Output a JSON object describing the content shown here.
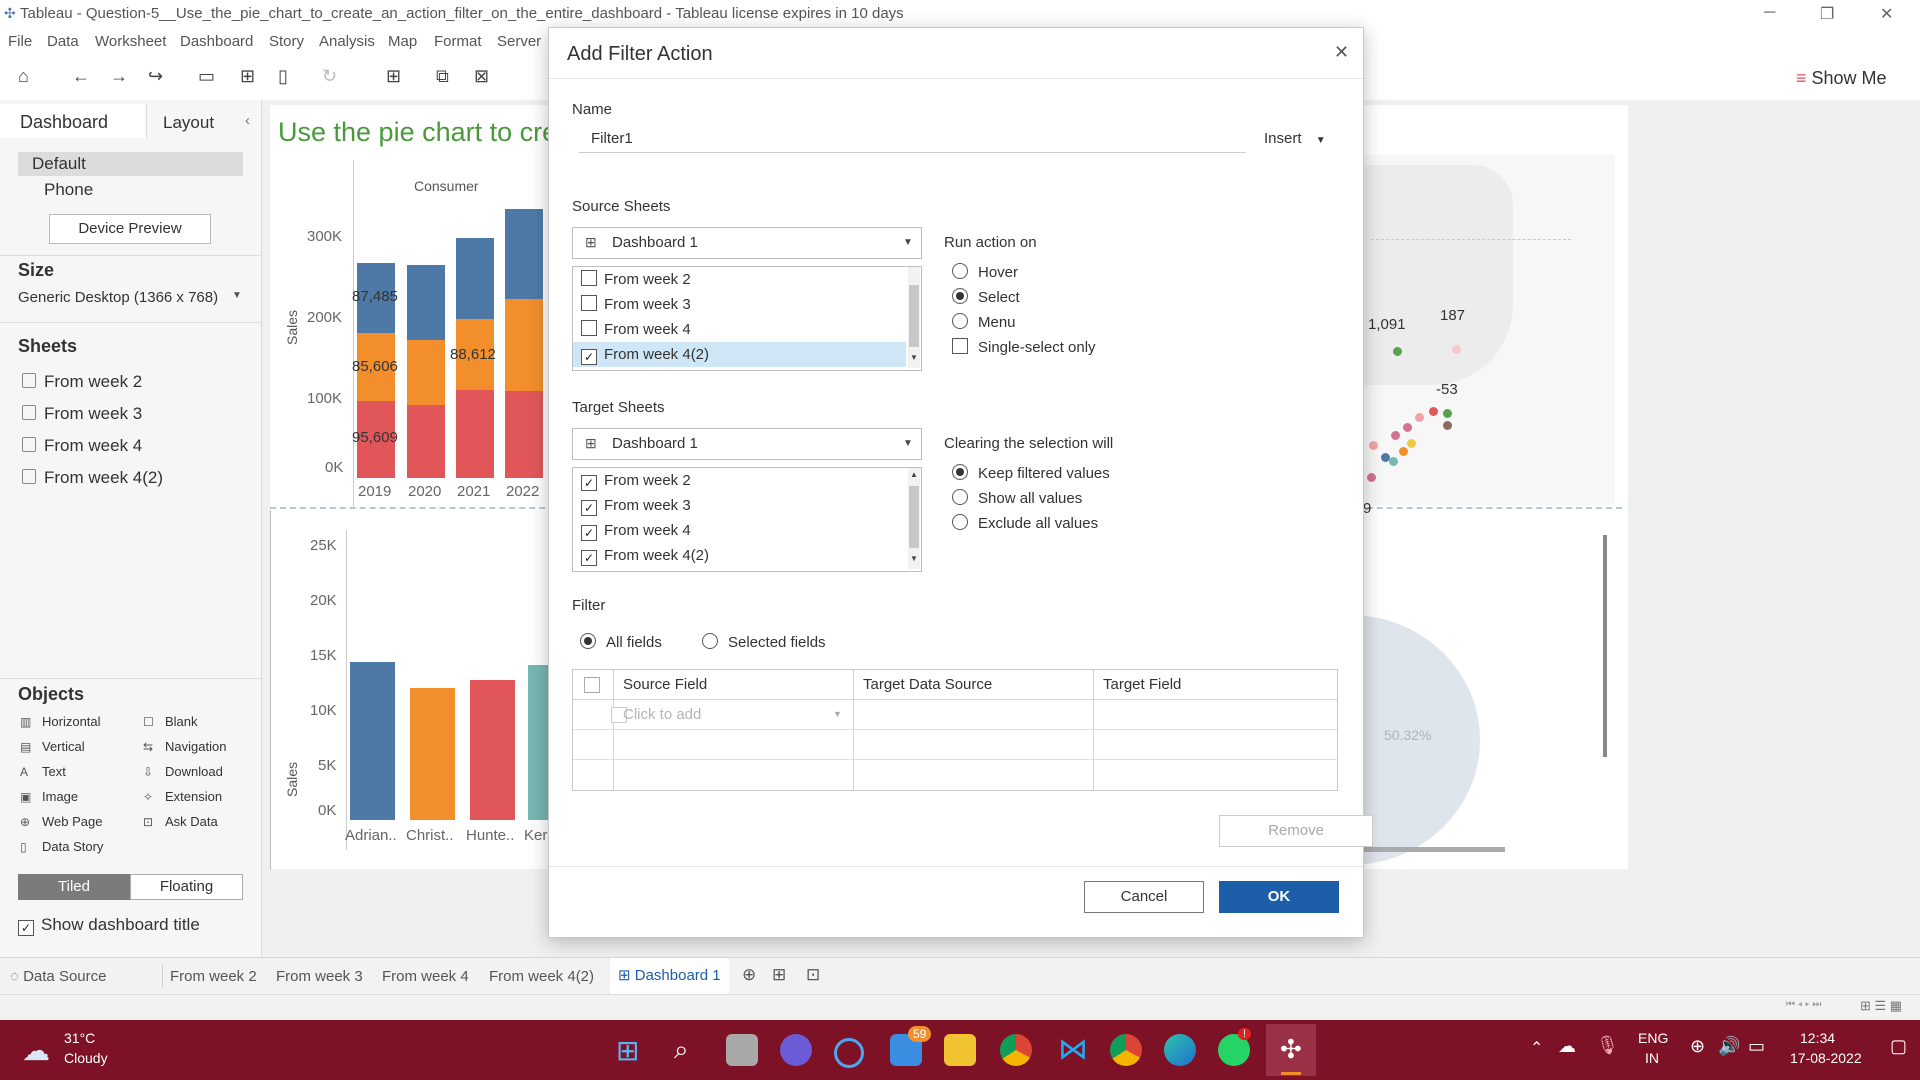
{
  "window": {
    "title": "Tableau - Question-5__Use_the_pie_chart_to_create_an_action_filter_on_the_entire_dashboard - Tableau license expires in 10 days"
  },
  "menu": [
    "File",
    "Data",
    "Worksheet",
    "Dashboard",
    "Story",
    "Analysis",
    "Map",
    "Format",
    "Server"
  ],
  "toolbar": {
    "show_me": "Show Me"
  },
  "left_panel": {
    "tabs": [
      "Dashboard",
      "Layout"
    ],
    "device": [
      "Default",
      "Phone"
    ],
    "device_preview": "Device Preview",
    "size_title": "Size",
    "size_value": "Generic Desktop (1366 x 768)",
    "sheets_title": "Sheets",
    "sheets": [
      "From week 2",
      "From week 3",
      "From week 4",
      "From week 4(2)"
    ],
    "objects_title": "Objects",
    "objects_left": [
      "Horizontal",
      "Vertical",
      "Text",
      "Image",
      "Web Page",
      "Data Story"
    ],
    "objects_right": [
      "Blank",
      "Navigation",
      "Download",
      "Extension",
      "Ask Data"
    ],
    "tiled": "Tiled",
    "floating": "Floating",
    "show_title": "Show dashboard title"
  },
  "dashboard": {
    "title": "Use the pie chart to cre",
    "top_chart": {
      "header": "Consumer",
      "ylabel": "Sales",
      "yticks": [
        "300K",
        "200K",
        "100K",
        "0K"
      ],
      "xticks": [
        "2019",
        "2020",
        "2021",
        "2022"
      ],
      "labels": [
        "87,485",
        "85,606",
        "95,609",
        "88,612"
      ]
    },
    "bottom_chart": {
      "ylabel": "Sales",
      "yticks": [
        "25K",
        "20K",
        "15K",
        "10K",
        "5K",
        "0K"
      ],
      "xticks": [
        "Adrian..",
        "Christ..",
        "Hunte..",
        "Ker"
      ]
    },
    "map_labels": [
      "1,091",
      "187",
      "-53",
      "9"
    ],
    "pie_label": "50.32%",
    "colors": {
      "blue": "#4e79a7",
      "orange": "#f28e2b",
      "red": "#e15759",
      "teal": "#76b7b2",
      "green_title": "#4a9a3b"
    }
  },
  "dialog": {
    "title": "Add Filter Action",
    "name_label": "Name",
    "name_value": "Filter1",
    "insert": "Insert",
    "source_label": "Source Sheets",
    "source_select": "Dashboard 1",
    "source_items": [
      {
        "label": "From week 2",
        "checked": false
      },
      {
        "label": "From week 3",
        "checked": false
      },
      {
        "label": "From week 4",
        "checked": false
      },
      {
        "label": "From week 4(2)",
        "checked": true
      }
    ],
    "run_label": "Run action on",
    "run_options": [
      "Hover",
      "Select",
      "Menu"
    ],
    "run_selected": "Select",
    "single_select": "Single-select only",
    "target_label": "Target Sheets",
    "target_select": "Dashboard 1",
    "target_items": [
      {
        "label": "From week 2",
        "checked": true
      },
      {
        "label": "From week 3",
        "checked": true
      },
      {
        "label": "From week 4",
        "checked": true
      },
      {
        "label": "From week 4(2)",
        "checked": true
      }
    ],
    "clear_label": "Clearing the selection will",
    "clear_options": [
      "Keep filtered values",
      "Show all values",
      "Exclude all values"
    ],
    "clear_selected": "Keep filtered values",
    "filter_label": "Filter",
    "filter_options": [
      "All fields",
      "Selected fields"
    ],
    "filter_selected": "All fields",
    "columns": [
      "Source Field",
      "Target Data Source",
      "Target Field"
    ],
    "click_to_add": "Click to add",
    "remove": "Remove",
    "cancel": "Cancel",
    "ok": "OK"
  },
  "sheet_tabs": [
    "Data Source",
    "From week 2",
    "From week 3",
    "From week 4",
    "From week 4(2)",
    "Dashboard 1"
  ],
  "taskbar": {
    "temp": "31°C",
    "weather": "Cloudy",
    "mail_badge": "59",
    "lang1": "ENG",
    "lang2": "IN",
    "time": "12:34",
    "date": "17-08-2022"
  }
}
